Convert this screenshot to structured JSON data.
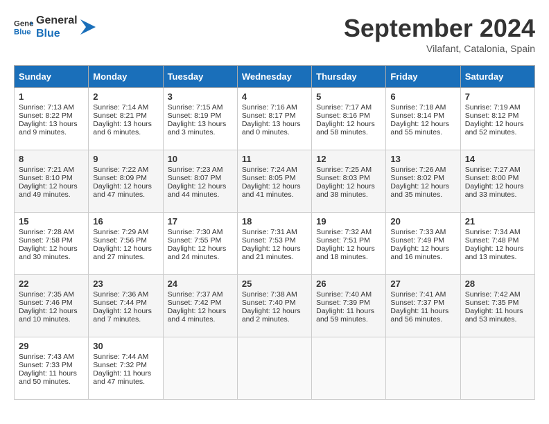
{
  "header": {
    "logo_line1": "General",
    "logo_line2": "Blue",
    "month": "September 2024",
    "location": "Vilafant, Catalonia, Spain"
  },
  "days_of_week": [
    "Sunday",
    "Monday",
    "Tuesday",
    "Wednesday",
    "Thursday",
    "Friday",
    "Saturday"
  ],
  "weeks": [
    [
      {
        "day": "1",
        "sunrise": "Sunrise: 7:13 AM",
        "sunset": "Sunset: 8:22 PM",
        "daylight": "Daylight: 13 hours and 9 minutes."
      },
      {
        "day": "2",
        "sunrise": "Sunrise: 7:14 AM",
        "sunset": "Sunset: 8:21 PM",
        "daylight": "Daylight: 13 hours and 6 minutes."
      },
      {
        "day": "3",
        "sunrise": "Sunrise: 7:15 AM",
        "sunset": "Sunset: 8:19 PM",
        "daylight": "Daylight: 13 hours and 3 minutes."
      },
      {
        "day": "4",
        "sunrise": "Sunrise: 7:16 AM",
        "sunset": "Sunset: 8:17 PM",
        "daylight": "Daylight: 13 hours and 0 minutes."
      },
      {
        "day": "5",
        "sunrise": "Sunrise: 7:17 AM",
        "sunset": "Sunset: 8:16 PM",
        "daylight": "Daylight: 12 hours and 58 minutes."
      },
      {
        "day": "6",
        "sunrise": "Sunrise: 7:18 AM",
        "sunset": "Sunset: 8:14 PM",
        "daylight": "Daylight: 12 hours and 55 minutes."
      },
      {
        "day": "7",
        "sunrise": "Sunrise: 7:19 AM",
        "sunset": "Sunset: 8:12 PM",
        "daylight": "Daylight: 12 hours and 52 minutes."
      }
    ],
    [
      {
        "day": "8",
        "sunrise": "Sunrise: 7:21 AM",
        "sunset": "Sunset: 8:10 PM",
        "daylight": "Daylight: 12 hours and 49 minutes."
      },
      {
        "day": "9",
        "sunrise": "Sunrise: 7:22 AM",
        "sunset": "Sunset: 8:09 PM",
        "daylight": "Daylight: 12 hours and 47 minutes."
      },
      {
        "day": "10",
        "sunrise": "Sunrise: 7:23 AM",
        "sunset": "Sunset: 8:07 PM",
        "daylight": "Daylight: 12 hours and 44 minutes."
      },
      {
        "day": "11",
        "sunrise": "Sunrise: 7:24 AM",
        "sunset": "Sunset: 8:05 PM",
        "daylight": "Daylight: 12 hours and 41 minutes."
      },
      {
        "day": "12",
        "sunrise": "Sunrise: 7:25 AM",
        "sunset": "Sunset: 8:03 PM",
        "daylight": "Daylight: 12 hours and 38 minutes."
      },
      {
        "day": "13",
        "sunrise": "Sunrise: 7:26 AM",
        "sunset": "Sunset: 8:02 PM",
        "daylight": "Daylight: 12 hours and 35 minutes."
      },
      {
        "day": "14",
        "sunrise": "Sunrise: 7:27 AM",
        "sunset": "Sunset: 8:00 PM",
        "daylight": "Daylight: 12 hours and 33 minutes."
      }
    ],
    [
      {
        "day": "15",
        "sunrise": "Sunrise: 7:28 AM",
        "sunset": "Sunset: 7:58 PM",
        "daylight": "Daylight: 12 hours and 30 minutes."
      },
      {
        "day": "16",
        "sunrise": "Sunrise: 7:29 AM",
        "sunset": "Sunset: 7:56 PM",
        "daylight": "Daylight: 12 hours and 27 minutes."
      },
      {
        "day": "17",
        "sunrise": "Sunrise: 7:30 AM",
        "sunset": "Sunset: 7:55 PM",
        "daylight": "Daylight: 12 hours and 24 minutes."
      },
      {
        "day": "18",
        "sunrise": "Sunrise: 7:31 AM",
        "sunset": "Sunset: 7:53 PM",
        "daylight": "Daylight: 12 hours and 21 minutes."
      },
      {
        "day": "19",
        "sunrise": "Sunrise: 7:32 AM",
        "sunset": "Sunset: 7:51 PM",
        "daylight": "Daylight: 12 hours and 18 minutes."
      },
      {
        "day": "20",
        "sunrise": "Sunrise: 7:33 AM",
        "sunset": "Sunset: 7:49 PM",
        "daylight": "Daylight: 12 hours and 16 minutes."
      },
      {
        "day": "21",
        "sunrise": "Sunrise: 7:34 AM",
        "sunset": "Sunset: 7:48 PM",
        "daylight": "Daylight: 12 hours and 13 minutes."
      }
    ],
    [
      {
        "day": "22",
        "sunrise": "Sunrise: 7:35 AM",
        "sunset": "Sunset: 7:46 PM",
        "daylight": "Daylight: 12 hours and 10 minutes."
      },
      {
        "day": "23",
        "sunrise": "Sunrise: 7:36 AM",
        "sunset": "Sunset: 7:44 PM",
        "daylight": "Daylight: 12 hours and 7 minutes."
      },
      {
        "day": "24",
        "sunrise": "Sunrise: 7:37 AM",
        "sunset": "Sunset: 7:42 PM",
        "daylight": "Daylight: 12 hours and 4 minutes."
      },
      {
        "day": "25",
        "sunrise": "Sunrise: 7:38 AM",
        "sunset": "Sunset: 7:40 PM",
        "daylight": "Daylight: 12 hours and 2 minutes."
      },
      {
        "day": "26",
        "sunrise": "Sunrise: 7:40 AM",
        "sunset": "Sunset: 7:39 PM",
        "daylight": "Daylight: 11 hours and 59 minutes."
      },
      {
        "day": "27",
        "sunrise": "Sunrise: 7:41 AM",
        "sunset": "Sunset: 7:37 PM",
        "daylight": "Daylight: 11 hours and 56 minutes."
      },
      {
        "day": "28",
        "sunrise": "Sunrise: 7:42 AM",
        "sunset": "Sunset: 7:35 PM",
        "daylight": "Daylight: 11 hours and 53 minutes."
      }
    ],
    [
      {
        "day": "29",
        "sunrise": "Sunrise: 7:43 AM",
        "sunset": "Sunset: 7:33 PM",
        "daylight": "Daylight: 11 hours and 50 minutes."
      },
      {
        "day": "30",
        "sunrise": "Sunrise: 7:44 AM",
        "sunset": "Sunset: 7:32 PM",
        "daylight": "Daylight: 11 hours and 47 minutes."
      },
      {
        "day": "",
        "sunrise": "",
        "sunset": "",
        "daylight": ""
      },
      {
        "day": "",
        "sunrise": "",
        "sunset": "",
        "daylight": ""
      },
      {
        "day": "",
        "sunrise": "",
        "sunset": "",
        "daylight": ""
      },
      {
        "day": "",
        "sunrise": "",
        "sunset": "",
        "daylight": ""
      },
      {
        "day": "",
        "sunrise": "",
        "sunset": "",
        "daylight": ""
      }
    ]
  ]
}
